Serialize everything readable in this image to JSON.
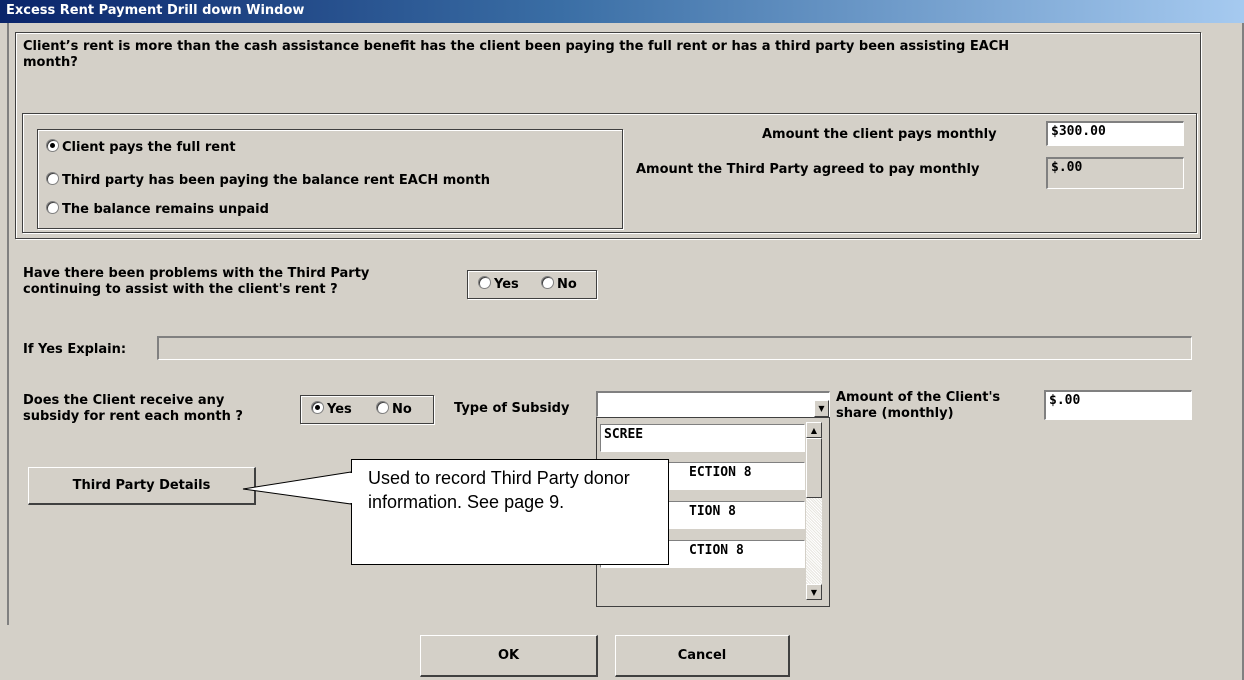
{
  "window": {
    "title": "Excess Rent Payment Drill down Window"
  },
  "question_rent": "Client’s rent is more than the cash assistance benefit has the client been paying the full rent or has a third party been assisting EACH month?",
  "payment_options": [
    {
      "label": "Client pays the full rent",
      "selected": true
    },
    {
      "label": "Third party has been paying the balance rent EACH month",
      "selected": false
    },
    {
      "label": "The balance remains unpaid",
      "selected": false
    }
  ],
  "client_pays": {
    "label": "Amount the client pays monthly",
    "value": "$300.00"
  },
  "third_party_pays": {
    "label": "Amount the Third Party agreed to pay monthly",
    "value": "$.00"
  },
  "problems": {
    "label_line1": "Have there been problems with the Third Party",
    "label_line2": "continuing to assist with the client's rent ?",
    "yes": "Yes",
    "no": "No"
  },
  "explain": {
    "label": "If Yes Explain:",
    "value": ""
  },
  "subsidy": {
    "label_line1": "Does the Client receive any",
    "label_line2": "subsidy for rent each month ?",
    "yes": "Yes",
    "no": "No",
    "selected": "Yes",
    "type_label": "Type of Subsidy",
    "type_value": "",
    "options": [
      "SCREE",
      "ECTION 8",
      "TION 8",
      "CTION 8"
    ]
  },
  "client_share": {
    "label_line1": "Amount of the Client's",
    "label_line2": "share (monthly)",
    "value": "$.00"
  },
  "third_party_button": "Third Party Details",
  "callout": {
    "text": "Used to record Third Party donor information. See page 9."
  },
  "buttons": {
    "ok": "OK",
    "cancel": "Cancel"
  }
}
